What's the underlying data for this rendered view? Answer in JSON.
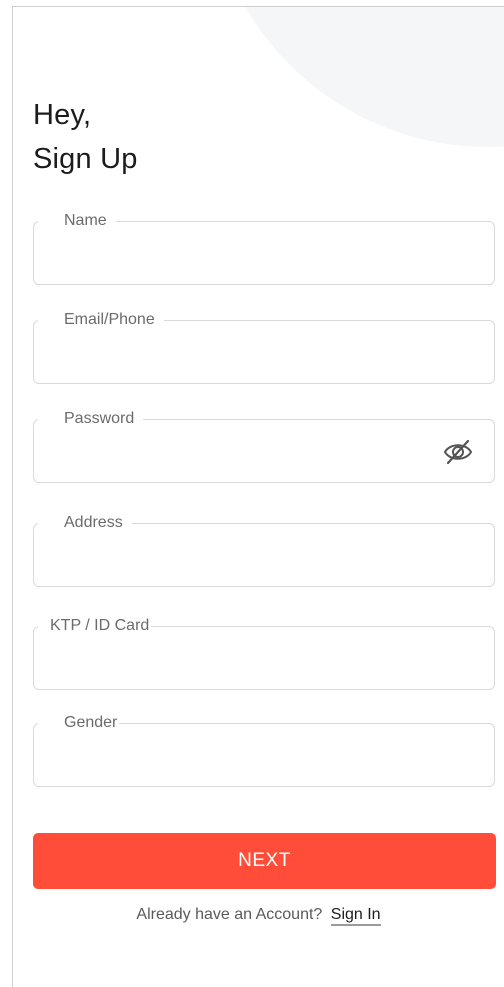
{
  "header": {
    "line1": "Hey,",
    "line2": "Sign Up"
  },
  "form": {
    "name_label": "Name",
    "name_value": "",
    "email_label": "Email/Phone",
    "email_value": "",
    "password_label": "Password",
    "password_value": "",
    "password_toggle_icon": "eye-off-icon",
    "address_label": "Address",
    "address_value": "",
    "ktp_label": "KTP / ID Card",
    "ktp_value": "",
    "gender_label": "Gender",
    "gender_value": ""
  },
  "actions": {
    "next_label": "NEXT"
  },
  "footer": {
    "prompt": "Already have an Account?",
    "signin_label": "Sign In"
  },
  "colors": {
    "accent": "#ff4d3a",
    "background_shape": "#f5f6f8",
    "border": "#d9d9d9"
  }
}
